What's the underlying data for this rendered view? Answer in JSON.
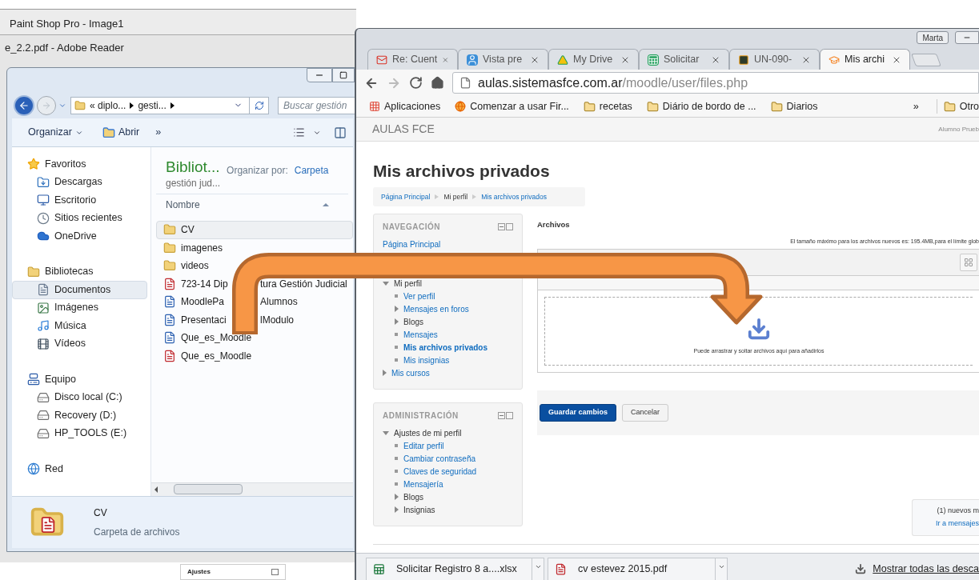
{
  "background_windows": [
    {
      "title": "Paint Shop Pro - Image1"
    },
    {
      "title": "e_2.2.pdf - Adobe Reader"
    }
  ],
  "background_label": "Ajustes",
  "explorer": {
    "address": [
      "« diplo...",
      "gesti..."
    ],
    "search": {
      "placeholder": "Buscar gestión"
    },
    "toolbar": {
      "organize": "Organizar",
      "open": "Abrir",
      "more": "»"
    },
    "tree": [
      {
        "label": "Favoritos",
        "kind": "star",
        "selected": false,
        "children": [
          {
            "label": "Descargas",
            "kind": "download",
            "selected": false
          },
          {
            "label": "Escritorio",
            "kind": "desktop",
            "selected": false
          },
          {
            "label": "Sitios recientes",
            "kind": "recent",
            "selected": false
          },
          {
            "label": "OneDrive",
            "kind": "cloud",
            "selected": false
          }
        ]
      },
      {
        "label": "Bibliotecas",
        "kind": "library",
        "selected": false,
        "children": [
          {
            "label": "Documentos",
            "kind": "document",
            "selected": true
          },
          {
            "label": "Imágenes",
            "kind": "image",
            "selected": false
          },
          {
            "label": "Música",
            "kind": "music",
            "selected": false
          },
          {
            "label": "Vídeos",
            "kind": "video",
            "selected": false
          }
        ]
      },
      {
        "label": "Equipo",
        "kind": "computer",
        "selected": false,
        "children": [
          {
            "label": "Disco local (C:)",
            "kind": "drive",
            "selected": false
          },
          {
            "label": "Recovery (D:)",
            "kind": "drive",
            "selected": false
          },
          {
            "label": "HP_TOOLS (E:)",
            "kind": "drive",
            "selected": false
          }
        ]
      },
      {
        "label": "Red",
        "kind": "network",
        "selected": false
      }
    ],
    "library": {
      "title": "Bibliot...",
      "subtitle": "gestión jud...",
      "arrange_label": "Organizar por:",
      "arrange_value": "Carpeta"
    },
    "column": "Nombre",
    "files": [
      {
        "parts": [
          "CV"
        ],
        "kind": "folder",
        "selected": true
      },
      {
        "parts": [
          "imagenes"
        ],
        "kind": "folder",
        "selected": false
      },
      {
        "parts": [
          "videos"
        ],
        "kind": "folder",
        "selected": false
      },
      {
        "parts": [
          "723-14 Dip",
          "tura Gestión Judicial"
        ],
        "kind": "pdf",
        "selected": false
      },
      {
        "parts": [
          "MoodlePa",
          "Alumnos"
        ],
        "kind": "word",
        "selected": false
      },
      {
        "parts": [
          "Presentaci",
          "lModulo"
        ],
        "kind": "word",
        "selected": false
      },
      {
        "parts": [
          "Que_es_Moodle"
        ],
        "kind": "word",
        "selected": false
      },
      {
        "parts": [
          "Que_es_Moodle"
        ],
        "kind": "pdf",
        "selected": false
      }
    ],
    "details": {
      "name": "CV",
      "type": "Carpeta de archivos"
    }
  },
  "browser": {
    "user": "Marta",
    "tabs": [
      {
        "title": "Re: Cuent",
        "kind": "mail",
        "selected": false
      },
      {
        "title": "Vista pre",
        "kind": "contact",
        "selected": false
      },
      {
        "title": "My Drive",
        "kind": "drive",
        "selected": false
      },
      {
        "title": "Solicitar",
        "kind": "sheet",
        "selected": false
      },
      {
        "title": "UN-090-",
        "kind": "in",
        "selected": false
      },
      {
        "title": "Mis archi",
        "kind": "moodle",
        "selected": true
      }
    ],
    "url": {
      "host": "aulas.sistemasfce.com.ar",
      "path": "/moodle/user/files.php"
    },
    "bookmarks": [
      {
        "label": "Aplicaciones",
        "kind": "apps"
      },
      {
        "label": "Comenzar a usar Fir...",
        "kind": "firefox"
      },
      {
        "label": "recetas",
        "kind": "folder"
      },
      {
        "label": "Diário de bordo de ...",
        "kind": "folder"
      },
      {
        "label": "Diarios",
        "kind": "folder"
      }
    ],
    "bookmarks_more": "»",
    "bookmarks_other": "Otro"
  },
  "moodle": {
    "site": "AULAS FCE",
    "user": "Alumno Prueb",
    "heading": "Mis archivos privados",
    "breadcrumb": [
      "Página Principal",
      "Mi perfil",
      "Mis archivos privados"
    ],
    "blocks": [
      {
        "title": "NAVEGACIÓN",
        "items": [
          {
            "label": "Página Principal",
            "kind": "plain",
            "link": true,
            "selected": false
          },
          {
            "label": "Mi perfil",
            "kind": "branch",
            "link": false,
            "expanded": true,
            "selected": false,
            "children": [
              {
                "label": "Ver perfil",
                "kind": "leaf",
                "link": true,
                "selected": false
              },
              {
                "label": "Mensajes en foros",
                "kind": "branch",
                "link": true,
                "expanded": false,
                "selected": false
              },
              {
                "label": "Blogs",
                "kind": "branch",
                "link": false,
                "expanded": false,
                "selected": false
              },
              {
                "label": "Mensajes",
                "kind": "leaf",
                "link": true,
                "selected": false
              },
              {
                "label": "Mis archivos privados",
                "kind": "leaf",
                "link": true,
                "selected": true
              },
              {
                "label": "Mis insignias",
                "kind": "leaf",
                "link": true,
                "selected": false
              }
            ]
          },
          {
            "label": "Mis cursos",
            "kind": "branch",
            "link": true,
            "expanded": false,
            "selected": false
          }
        ]
      },
      {
        "title": "ADMINISTRACIÓN",
        "items": [
          {
            "label": "Ajustes de mi perfil",
            "kind": "branch",
            "link": false,
            "expanded": true,
            "selected": false,
            "children": [
              {
                "label": "Editar perfil",
                "kind": "leaf",
                "link": true,
                "selected": false
              },
              {
                "label": "Cambiar contraseña",
                "kind": "leaf",
                "link": true,
                "selected": false
              },
              {
                "label": "Claves de seguridad",
                "kind": "leaf",
                "link": true,
                "selected": false
              },
              {
                "label": "Mensajería",
                "kind": "leaf",
                "link": true,
                "selected": false
              },
              {
                "label": "Blogs",
                "kind": "branch",
                "link": false,
                "expanded": false,
                "selected": false
              },
              {
                "label": "Insignias",
                "kind": "branch",
                "link": false,
                "expanded": false,
                "selected": false
              }
            ]
          }
        ]
      }
    ],
    "files": {
      "label": "Archivos",
      "limit_note": "El tamaño máximo para los archivos nuevos es: 195.4MB,para el límite glob",
      "drop_hint": "Puede arrastrar y soltar archivos aquí para añadirlos"
    },
    "buttons": [
      {
        "label": "Guardar cambios",
        "kind": "primary"
      },
      {
        "label": "Cancelar",
        "kind": "secondary"
      }
    ],
    "messages": {
      "text": "(1) nuevos m",
      "link": "Ir a mensajes"
    }
  },
  "downloads": {
    "items": [
      {
        "name": "Solicitar Registro 8 a....xlsx",
        "kind": "excel"
      },
      {
        "name": "cv estevez 2015.pdf",
        "kind": "pdf"
      }
    ],
    "show_all": "Mostrar todas las desca"
  }
}
